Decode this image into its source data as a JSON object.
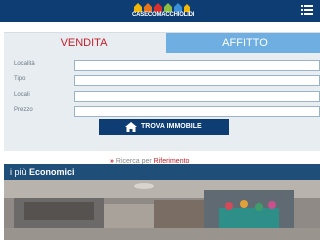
{
  "header": {
    "logo_text": "CASECOMACCHIOLIDI",
    "menu_icon": "list-icon"
  },
  "tabs": {
    "vendita": "VENDITA",
    "affitto": "AFFITTO"
  },
  "form": {
    "localita_label": "Località",
    "tipo_label": "Tipo",
    "locali_label": "Locali",
    "prezzo_label": "Prezzo",
    "localita_value": "",
    "tipo_value": "",
    "locali_value": "",
    "prezzo_value": ""
  },
  "search_button": {
    "label": "TROVA IMMOBILE",
    "icon": "home-icon"
  },
  "reference_link": {
    "prefix": "Ricerca per ",
    "highlight": "Riferimento"
  },
  "economici": {
    "prefix": "i più ",
    "bold": "Economici"
  },
  "colors": {
    "header_bg": "#0d3d73",
    "vendita_text": "#c4202b",
    "affitto_bg": "#6eaee0",
    "panel_bg": "#e8edf1",
    "section_bar": "#1f4e79"
  }
}
